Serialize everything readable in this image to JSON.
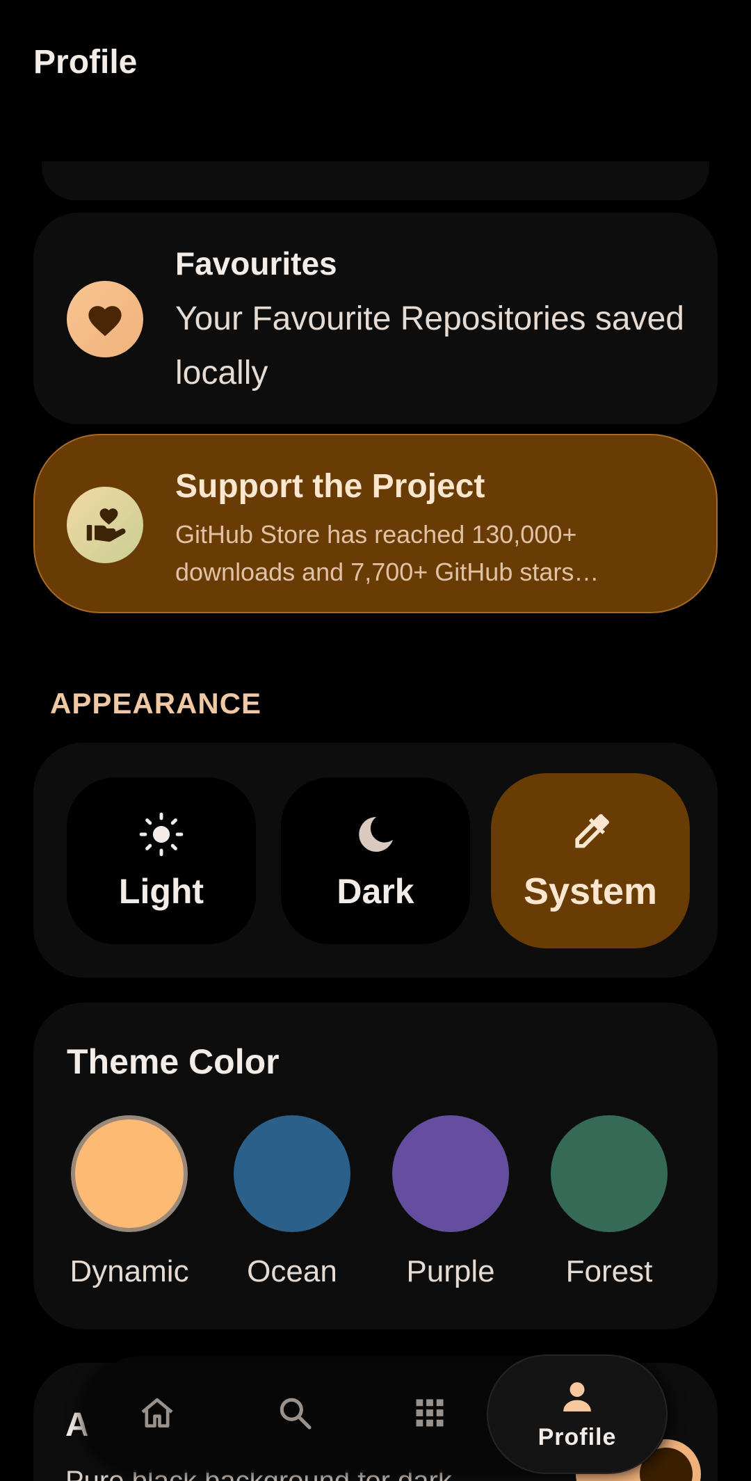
{
  "header": {
    "title": "Profile"
  },
  "favourites": {
    "title": "Favourites",
    "subtitle": "Your Favourite Repositories saved locally",
    "icon": "heart-icon"
  },
  "support": {
    "title": "Support the Project",
    "text": "GitHub Store has reached 130,000+ downloads and 7,700+ GitHub stars…",
    "icon": "hand-heart-icon"
  },
  "appearance": {
    "section_label": "APPEARANCE",
    "modes": [
      {
        "label": "Light",
        "icon": "sun-icon",
        "selected": false
      },
      {
        "label": "Dark",
        "icon": "moon-icon",
        "selected": false
      },
      {
        "label": "System",
        "icon": "eyedropper-icon",
        "selected": true
      }
    ]
  },
  "theme_color": {
    "title": "Theme Color",
    "options": [
      {
        "label": "Dynamic",
        "color": "#fdba74",
        "selected": true
      },
      {
        "label": "Ocean",
        "color": "#2a6089",
        "selected": false
      },
      {
        "label": "Purple",
        "color": "#654d9f",
        "selected": false
      },
      {
        "label": "Forest",
        "color": "#356a56",
        "selected": false
      }
    ]
  },
  "amoled": {
    "title": "A",
    "subtitle": "Pure black background for dark",
    "toggle_on": true
  },
  "nav": {
    "items": [
      {
        "icon": "home-icon",
        "label": ""
      },
      {
        "icon": "search-icon",
        "label": ""
      },
      {
        "icon": "apps-grid-icon",
        "label": ""
      },
      {
        "icon": "person-icon",
        "label": "Profile",
        "selected": true
      }
    ]
  },
  "colors": {
    "background": "#000000",
    "card": "#0d0d0d",
    "accent": "#f0b27c",
    "selected_container": "#6a3c05"
  }
}
